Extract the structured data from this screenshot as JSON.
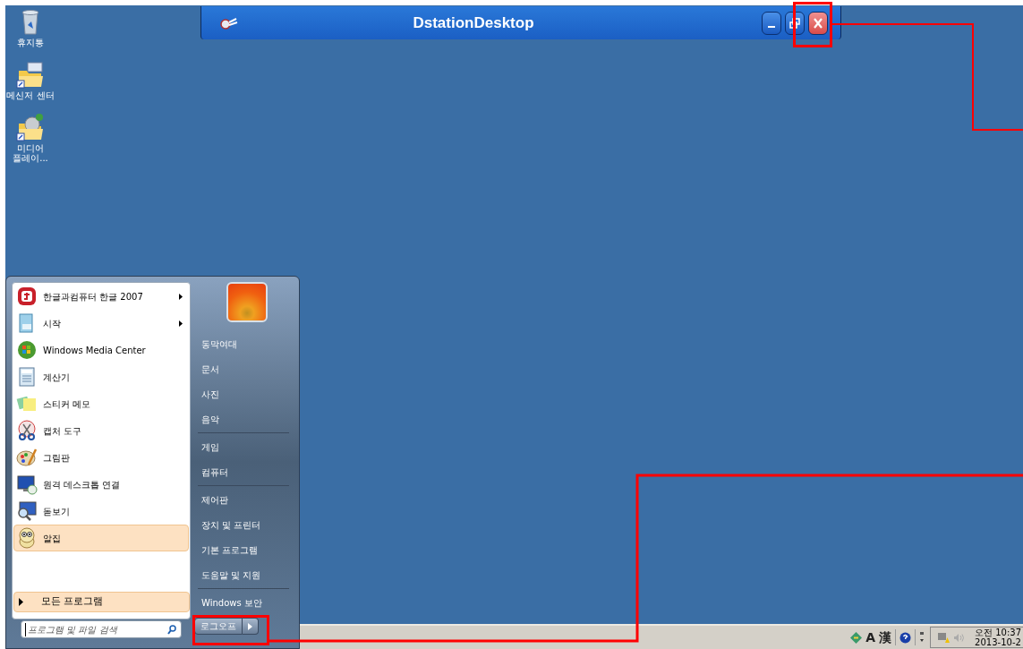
{
  "desktop_icons": [
    {
      "label": "휴지통",
      "kind": "recycle-bin"
    },
    {
      "label": "메신저 센터",
      "kind": "messenger-folder"
    },
    {
      "label": "미디어 플레이...",
      "kind": "media-folder"
    }
  ],
  "window": {
    "title": "DstationDesktop",
    "buttons": [
      {
        "kind": "minimize"
      },
      {
        "kind": "restore"
      },
      {
        "kind": "close"
      }
    ]
  },
  "start_menu": {
    "programs": [
      {
        "label": "한글과컴퓨터 한글 2007",
        "submenu": true,
        "selected": false
      },
      {
        "label": "시작",
        "submenu": true,
        "selected": false
      },
      {
        "label": "Windows Media Center",
        "submenu": false,
        "selected": false
      },
      {
        "label": "계산기",
        "submenu": false,
        "selected": false
      },
      {
        "label": "스티커 메모",
        "submenu": false,
        "selected": false
      },
      {
        "label": "캡처 도구",
        "submenu": false,
        "selected": false
      },
      {
        "label": "그림판",
        "submenu": false,
        "selected": false
      },
      {
        "label": "원격 데스크톱 연결",
        "submenu": false,
        "selected": false
      },
      {
        "label": "돋보기",
        "submenu": false,
        "selected": false
      },
      {
        "label": "알집",
        "submenu": false,
        "selected": true
      }
    ],
    "all_programs": {
      "label": "모든 프로그램"
    },
    "search": {
      "placeholder": "프로그램 및 파일 검색"
    },
    "places": [
      [
        "동막여대",
        "문서",
        "사진",
        "음악"
      ],
      [
        "게임",
        "컴퓨터"
      ],
      [
        "제어판",
        "장치 및 프린터",
        "기본 프로그램",
        "도움말 및 지원"
      ],
      [
        "Windows 보안"
      ]
    ],
    "shutdown": {
      "label": "로그오프"
    }
  },
  "taskbar": {
    "language": [
      "A",
      "漢"
    ],
    "clock": {
      "time": "오전 10:37",
      "date": "2013-10-2"
    }
  }
}
